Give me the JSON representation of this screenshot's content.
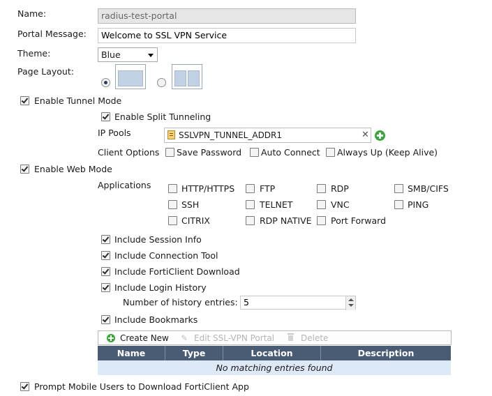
{
  "form": {
    "name_label": "Name:",
    "name_value": "radius-test-portal",
    "portal_message_label": "Portal Message:",
    "portal_message_value": "Welcome to SSL VPN Service",
    "theme_label": "Theme:",
    "theme_value": "Blue",
    "page_layout_label": "Page Layout:"
  },
  "tunnel": {
    "enable_label": "Enable Tunnel Mode",
    "enable_checked": true,
    "split_label": "Enable Split Tunneling",
    "split_checked": true,
    "ip_pools_label": "IP Pools",
    "ip_pool_value": "SSLVPN_TUNNEL_ADDR1",
    "client_options_label": "Client Options",
    "save_password_label": "Save Password",
    "auto_connect_label": "Auto Connect",
    "always_up_label": "Always Up (Keep Alive)"
  },
  "web": {
    "enable_label": "Enable Web Mode",
    "applications_label": "Applications",
    "apps": {
      "http": "HTTP/HTTPS",
      "ftp": "FTP",
      "rdp": "RDP",
      "smb": "SMB/CIFS",
      "ssh": "SSH",
      "telnet": "TELNET",
      "vnc": "VNC",
      "ping": "PING",
      "citrix": "CITRIX",
      "rdp_native": "RDP NATIVE",
      "port_forward": "Port Forward"
    },
    "session_info_label": "Include Session Info",
    "connection_tool_label": "Include Connection Tool",
    "forticlient_download_label": "Include FortiClient Download",
    "login_history_label": "Include Login History",
    "history_entries_label": "Number of history entries:",
    "history_entries_value": "5",
    "bookmarks_label": "Include Bookmarks"
  },
  "bookmarks_table": {
    "create_new": "Create New",
    "edit": "Edit SSL-VPN Portal",
    "delete": "Delete",
    "columns": [
      "Name",
      "Type",
      "Location",
      "Description"
    ],
    "empty_message": "No matching entries found"
  },
  "mobile": {
    "prompt_label": "Prompt Mobile Users to Download FortiClient App"
  },
  "colors": {
    "table_header": "#4a5c74",
    "table_empty_row": "#dde9f7",
    "add_button": "#3aa63a"
  }
}
